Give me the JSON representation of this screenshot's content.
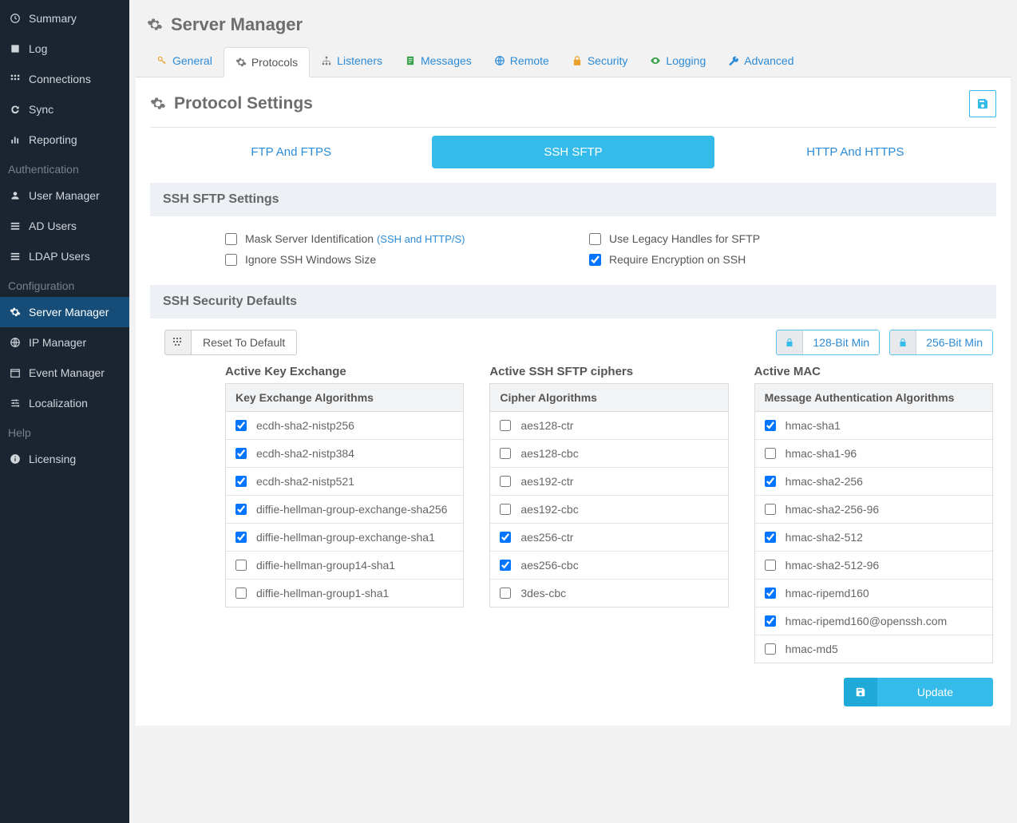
{
  "sidebar": {
    "groups": [
      {
        "items": [
          {
            "label": "Summary",
            "icon": "clock"
          },
          {
            "label": "Log",
            "icon": "book"
          },
          {
            "label": "Connections",
            "icon": "grid"
          },
          {
            "label": "Sync",
            "icon": "refresh"
          },
          {
            "label": "Reporting",
            "icon": "bars"
          }
        ]
      },
      {
        "header": "Authentication",
        "items": [
          {
            "label": "User Manager",
            "icon": "user"
          },
          {
            "label": "AD Users",
            "icon": "list"
          },
          {
            "label": "LDAP Users",
            "icon": "list"
          }
        ]
      },
      {
        "header": "Configuration",
        "items": [
          {
            "label": "Server Manager",
            "icon": "gear",
            "active": true
          },
          {
            "label": "IP Manager",
            "icon": "globe"
          },
          {
            "label": "Event Manager",
            "icon": "calendar"
          },
          {
            "label": "Localization",
            "icon": "sliders"
          }
        ]
      },
      {
        "header": "Help",
        "items": [
          {
            "label": "Licensing",
            "icon": "info"
          }
        ]
      }
    ]
  },
  "page": {
    "title": "Server Manager"
  },
  "tabs": [
    {
      "label": "General",
      "icon": "key",
      "color": "ic-orange"
    },
    {
      "label": "Protocols",
      "icon": "gear",
      "color": "ic-grey",
      "active": true
    },
    {
      "label": "Listeners",
      "icon": "sitemap",
      "color": "ic-grey"
    },
    {
      "label": "Messages",
      "icon": "doc",
      "color": "ic-green"
    },
    {
      "label": "Remote",
      "icon": "globe",
      "color": "ic-blue"
    },
    {
      "label": "Security",
      "icon": "lock",
      "color": "ic-orange"
    },
    {
      "label": "Logging",
      "icon": "eye",
      "color": "ic-green"
    },
    {
      "label": "Advanced",
      "icon": "wrench",
      "color": "ic-blue"
    }
  ],
  "card": {
    "title": "Protocol Settings"
  },
  "subtabs": [
    {
      "label": "FTP And FTPS"
    },
    {
      "label": "SSH SFTP",
      "active": true
    },
    {
      "label": "HTTP And HTTPS"
    }
  ],
  "sftp": {
    "title": "SSH SFTP Settings",
    "opts": [
      {
        "label": "Mask Server Identification",
        "hint": "(SSH and HTTP/S)",
        "checked": false
      },
      {
        "label": "Use Legacy Handles for SFTP",
        "checked": false
      },
      {
        "label": "Ignore SSH Windows Size",
        "checked": false
      },
      {
        "label": "Require Encryption on SSH",
        "checked": true
      }
    ]
  },
  "defaults": {
    "title": "SSH Security Defaults",
    "reset": "Reset To Default",
    "bit128": "128-Bit Min",
    "bit256": "256-Bit Min",
    "cols": [
      {
        "heading": "Active Key Exchange",
        "th": "Key Exchange Algorithms",
        "rows": [
          {
            "label": "ecdh-sha2-nistp256",
            "checked": true
          },
          {
            "label": "ecdh-sha2-nistp384",
            "checked": true
          },
          {
            "label": "ecdh-sha2-nistp521",
            "checked": true
          },
          {
            "label": "diffie-hellman-group-exchange-sha256",
            "checked": true
          },
          {
            "label": "diffie-hellman-group-exchange-sha1",
            "checked": true
          },
          {
            "label": "diffie-hellman-group14-sha1",
            "checked": false
          },
          {
            "label": "diffie-hellman-group1-sha1",
            "checked": false
          }
        ]
      },
      {
        "heading": "Active SSH SFTP ciphers",
        "th": "Cipher Algorithms",
        "rows": [
          {
            "label": "aes128-ctr",
            "checked": false
          },
          {
            "label": "aes128-cbc",
            "checked": false
          },
          {
            "label": "aes192-ctr",
            "checked": false
          },
          {
            "label": "aes192-cbc",
            "checked": false
          },
          {
            "label": "aes256-ctr",
            "checked": true
          },
          {
            "label": "aes256-cbc",
            "checked": true
          },
          {
            "label": "3des-cbc",
            "checked": false
          }
        ]
      },
      {
        "heading": "Active MAC",
        "th": "Message Authentication Algorithms",
        "rows": [
          {
            "label": "hmac-sha1",
            "checked": true
          },
          {
            "label": "hmac-sha1-96",
            "checked": false
          },
          {
            "label": "hmac-sha2-256",
            "checked": true
          },
          {
            "label": "hmac-sha2-256-96",
            "checked": false
          },
          {
            "label": "hmac-sha2-512",
            "checked": true
          },
          {
            "label": "hmac-sha2-512-96",
            "checked": false
          },
          {
            "label": "hmac-ripemd160",
            "checked": true
          },
          {
            "label": "hmac-ripemd160@openssh.com",
            "checked": true
          },
          {
            "label": "hmac-md5",
            "checked": false
          }
        ]
      }
    ]
  },
  "footer": {
    "update": "Update"
  }
}
